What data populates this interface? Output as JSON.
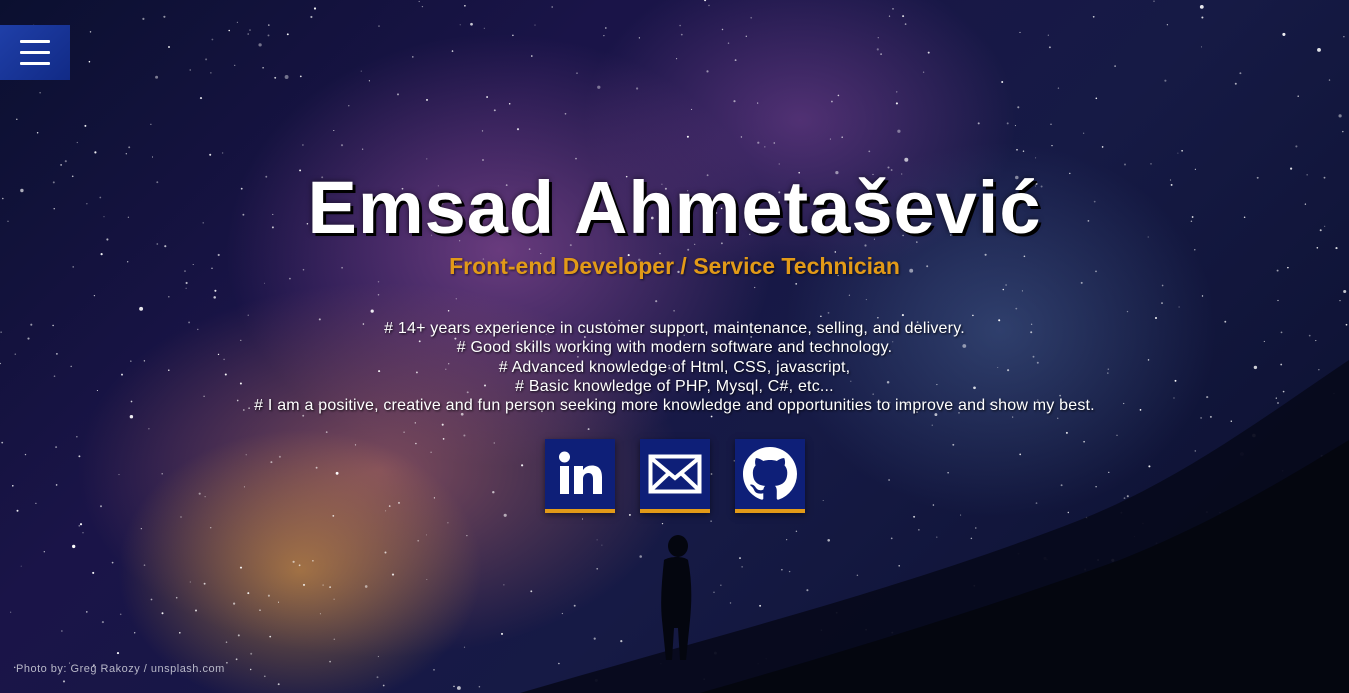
{
  "menu": {
    "icon": "hamburger-menu-icon"
  },
  "hero": {
    "title": "Emsad Ahmetašević",
    "subtitle": "Front-end Developer / Service Technician",
    "bio": [
      "# 14+ years experience in customer support, maintenance, selling, and delivery.",
      "# Good skills working with modern software and technology.",
      "# Advanced knowledge of Html, CSS, javascript,",
      "# Basic knowledge of PHP, Mysql, C#, etc...",
      "# I am a positive, creative and fun person seeking more knowledge and opportunities to improve and show my best."
    ]
  },
  "social": [
    {
      "icon": "linkedin-icon"
    },
    {
      "icon": "email-envelope-icon"
    },
    {
      "icon": "github-icon"
    }
  ],
  "footer": {
    "credit": "Photo by: Greg Rakozy / unsplash.com"
  },
  "colors": {
    "accent": "#e29a18",
    "button_bg": "#0e1f78",
    "menu_bg": "#1f3fa8",
    "title": "#ffffff"
  }
}
